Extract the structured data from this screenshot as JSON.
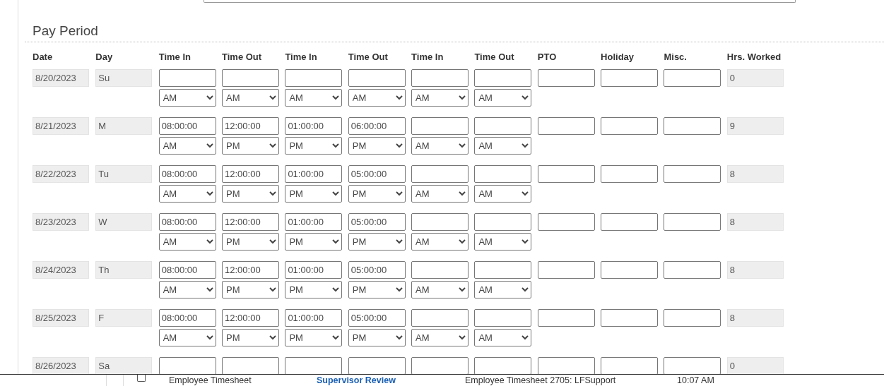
{
  "section": {
    "title": "Pay Period"
  },
  "columns": [
    "Date",
    "Day",
    "Time In",
    "Time Out",
    "Time In",
    "Time Out",
    "Time In",
    "Time Out",
    "PTO",
    "Holiday",
    "Misc.",
    "Hrs. Worked"
  ],
  "rows": [
    {
      "date": "8/20/2023",
      "day": "Su",
      "times": [
        {
          "period": "AM"
        },
        {
          "period": "AM"
        },
        {
          "period": "AM"
        },
        {
          "period": "AM"
        },
        {
          "period": "AM"
        },
        {
          "period": "AM"
        }
      ],
      "hours": "0"
    },
    {
      "date": "8/21/2023",
      "day": "M",
      "times": [
        {
          "value": "08:00:00",
          "period": "AM"
        },
        {
          "value": "12:00:00",
          "period": "PM"
        },
        {
          "value": "01:00:00",
          "period": "PM"
        },
        {
          "value": "06:00:00",
          "period": "PM"
        },
        {
          "period": "AM"
        },
        {
          "period": "AM"
        }
      ],
      "hours": "9"
    },
    {
      "date": "8/22/2023",
      "day": "Tu",
      "times": [
        {
          "value": "08:00:00",
          "period": "AM"
        },
        {
          "value": "12:00:00",
          "period": "PM"
        },
        {
          "value": "01:00:00",
          "period": "PM"
        },
        {
          "value": "05:00:00",
          "period": "PM"
        },
        {
          "period": "AM"
        },
        {
          "period": "AM"
        }
      ],
      "hours": "8"
    },
    {
      "date": "8/23/2023",
      "day": "W",
      "times": [
        {
          "value": "08:00:00",
          "period": "AM"
        },
        {
          "value": "12:00:00",
          "period": "PM"
        },
        {
          "value": "01:00:00",
          "period": "PM"
        },
        {
          "value": "05:00:00",
          "period": "PM"
        },
        {
          "period": "AM"
        },
        {
          "period": "AM"
        }
      ],
      "hours": "8"
    },
    {
      "date": "8/24/2023",
      "day": "Th",
      "times": [
        {
          "value": "08:00:00",
          "period": "AM"
        },
        {
          "value": "12:00:00",
          "period": "PM"
        },
        {
          "value": "01:00:00",
          "period": "PM"
        },
        {
          "value": "05:00:00",
          "period": "PM"
        },
        {
          "period": "AM"
        },
        {
          "period": "AM"
        }
      ],
      "hours": "8"
    },
    {
      "date": "8/25/2023",
      "day": "F",
      "times": [
        {
          "value": "08:00:00",
          "period": "AM"
        },
        {
          "value": "12:00:00",
          "period": "PM"
        },
        {
          "value": "01:00:00",
          "period": "PM"
        },
        {
          "value": "05:00:00",
          "period": "PM"
        },
        {
          "period": "AM"
        },
        {
          "period": "AM"
        }
      ],
      "hours": "8"
    },
    {
      "kind": "cut_off",
      "date": "8/26/2023",
      "day": "Sa",
      "hours": "0"
    }
  ],
  "task_bar": {
    "checked": false,
    "form": "Employee Timesheet",
    "step": "Supervisor Review",
    "instance": "Employee Timesheet 2705: LFSupport",
    "time": "10:07 AM"
  }
}
